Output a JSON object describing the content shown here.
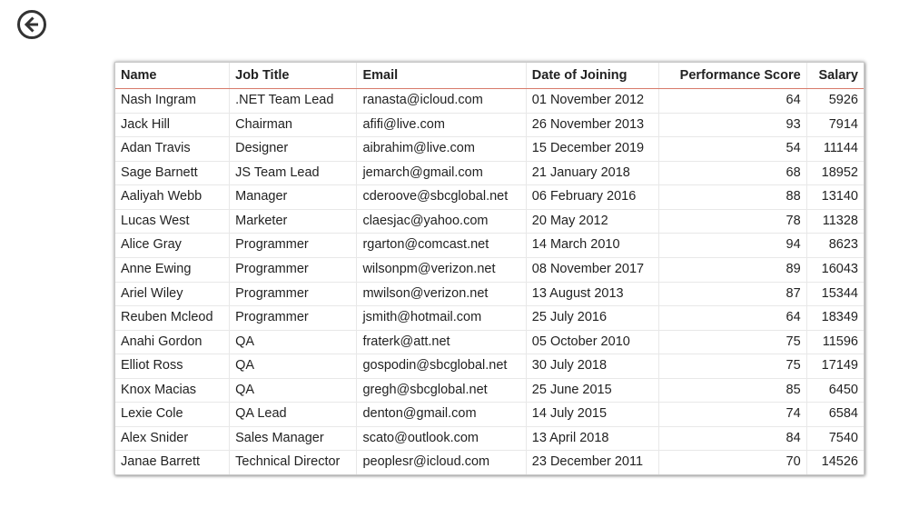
{
  "table": {
    "headers": {
      "name": "Name",
      "job": "Job Title",
      "email": "Email",
      "doj": "Date of Joining",
      "perf": "Performance Score",
      "salary": "Salary"
    },
    "rows": [
      {
        "name": "Nash Ingram",
        "job": ".NET Team Lead",
        "email": "ranasta@icloud.com",
        "doj": "01 November 2012",
        "perf": "64",
        "salary": "5926"
      },
      {
        "name": "Jack Hill",
        "job": "Chairman",
        "email": "afifi@live.com",
        "doj": "26 November 2013",
        "perf": "93",
        "salary": "7914"
      },
      {
        "name": "Adan Travis",
        "job": "Designer",
        "email": "aibrahim@live.com",
        "doj": "15 December 2019",
        "perf": "54",
        "salary": "11144"
      },
      {
        "name": "Sage Barnett",
        "job": "JS Team Lead",
        "email": "jemarch@gmail.com",
        "doj": "21 January 2018",
        "perf": "68",
        "salary": "18952"
      },
      {
        "name": "Aaliyah Webb",
        "job": "Manager",
        "email": "cderoove@sbcglobal.net",
        "doj": "06 February 2016",
        "perf": "88",
        "salary": "13140"
      },
      {
        "name": "Lucas West",
        "job": "Marketer",
        "email": "claesjac@yahoo.com",
        "doj": "20 May 2012",
        "perf": "78",
        "salary": "11328"
      },
      {
        "name": "Alice Gray",
        "job": "Programmer",
        "email": "rgarton@comcast.net",
        "doj": "14 March 2010",
        "perf": "94",
        "salary": "8623"
      },
      {
        "name": "Anne Ewing",
        "job": "Programmer",
        "email": "wilsonpm@verizon.net",
        "doj": "08 November 2017",
        "perf": "89",
        "salary": "16043"
      },
      {
        "name": "Ariel Wiley",
        "job": "Programmer",
        "email": "mwilson@verizon.net",
        "doj": "13 August 2013",
        "perf": "87",
        "salary": "15344"
      },
      {
        "name": "Reuben Mcleod",
        "job": "Programmer",
        "email": "jsmith@hotmail.com",
        "doj": "25 July 2016",
        "perf": "64",
        "salary": "18349"
      },
      {
        "name": "Anahi Gordon",
        "job": "QA",
        "email": "fraterk@att.net",
        "doj": "05 October 2010",
        "perf": "75",
        "salary": "11596"
      },
      {
        "name": "Elliot Ross",
        "job": "QA",
        "email": "gospodin@sbcglobal.net",
        "doj": "30 July 2018",
        "perf": "75",
        "salary": "17149"
      },
      {
        "name": "Knox Macias",
        "job": "QA",
        "email": "gregh@sbcglobal.net",
        "doj": "25 June 2015",
        "perf": "85",
        "salary": "6450"
      },
      {
        "name": "Lexie Cole",
        "job": "QA Lead",
        "email": "denton@gmail.com",
        "doj": "14 July 2015",
        "perf": "74",
        "salary": "6584"
      },
      {
        "name": "Alex Snider",
        "job": "Sales Manager",
        "email": "scato@outlook.com",
        "doj": "13 April 2018",
        "perf": "84",
        "salary": "7540"
      },
      {
        "name": "Janae Barrett",
        "job": "Technical Director",
        "email": "peoplesr@icloud.com",
        "doj": "23 December 2011",
        "perf": "70",
        "salary": "14526"
      }
    ]
  }
}
